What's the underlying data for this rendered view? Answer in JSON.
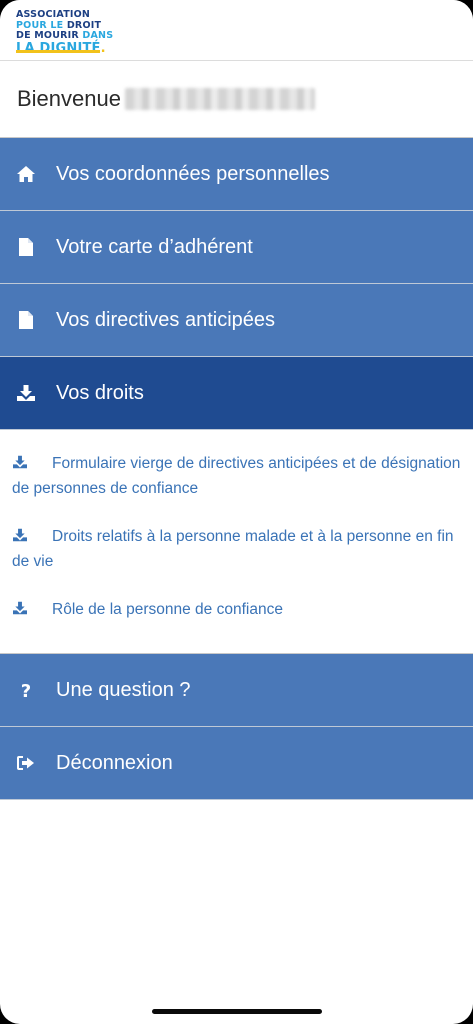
{
  "logo": {
    "line1": "ASSOCIATION",
    "line2a": "POUR LE",
    "line2b": "DROIT",
    "line3a": "DE MOURIR",
    "line3b": "DANS",
    "line4": "LA DIGNITÉ",
    "line4dot": "."
  },
  "welcome": {
    "label": "Bienvenue"
  },
  "menu": {
    "items": [
      {
        "label": "Vos coordonnées personnelles",
        "icon": "home-icon"
      },
      {
        "label": "Votre carte d’adhérent",
        "icon": "document-icon"
      },
      {
        "label": "Vos directives anticipées",
        "icon": "document-icon"
      },
      {
        "label": "Vos droits",
        "icon": "download-icon"
      }
    ],
    "active_index": 3
  },
  "downloads": [
    {
      "label": "Formulaire vierge de directives anticipées et de désignation de personnes de confiance",
      "icon": "download-icon"
    },
    {
      "label": "Droits relatifs à la personne malade et à la personne en fin de vie",
      "icon": "download-icon"
    },
    {
      "label": "Rôle de la personne de confiance",
      "icon": "download-icon"
    }
  ],
  "footer_menu": {
    "items": [
      {
        "label": "Une question ?",
        "icon": "question-icon"
      },
      {
        "label": "Déconnexion",
        "icon": "logout-icon"
      }
    ]
  },
  "colors": {
    "menu_bg": "#4a78b8",
    "menu_active_bg": "#1f4b91",
    "link": "#3a73b6",
    "logo_dark": "#1c3f83",
    "logo_light": "#2aa7df",
    "logo_accent": "#f2c21b"
  }
}
